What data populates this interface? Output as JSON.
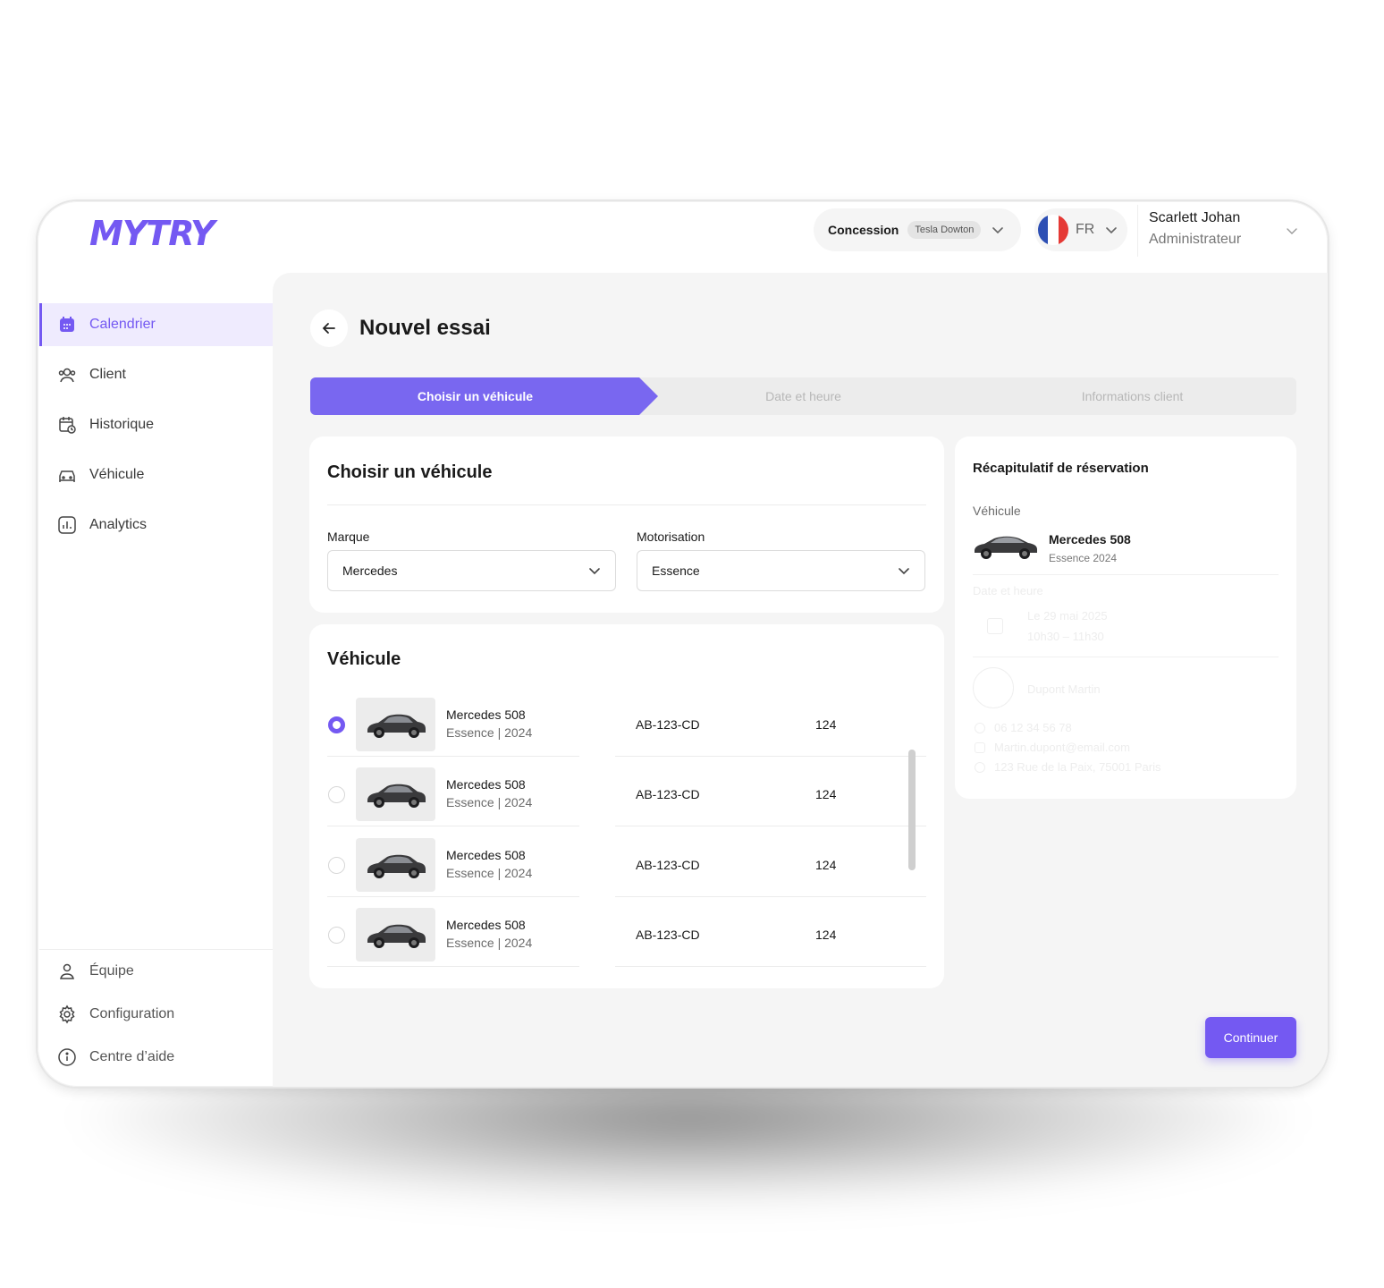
{
  "brand": {
    "logo_text": "MYTRY",
    "accent": "#7459f2"
  },
  "header": {
    "concession_label": "Concession",
    "concession_value": "Tesla Dowton",
    "language": "FR",
    "user_name": "Scarlett Johan",
    "user_role": "Administrateur"
  },
  "sidebar": {
    "items": [
      {
        "label": "Calendrier",
        "icon": "calendar-icon",
        "active": true
      },
      {
        "label": "Client",
        "icon": "users-icon"
      },
      {
        "label": "Historique",
        "icon": "calendar-clock-icon"
      },
      {
        "label": "Véhicule",
        "icon": "car-icon"
      },
      {
        "label": "Analytics",
        "icon": "chart-icon"
      }
    ],
    "bottom_items": [
      {
        "label": "Équipe",
        "icon": "user-icon"
      },
      {
        "label": "Configuration",
        "icon": "gear-icon"
      },
      {
        "label": "Centre d’aide",
        "icon": "info-icon"
      }
    ]
  },
  "page": {
    "title": "Nouvel essai"
  },
  "stepper": {
    "steps": [
      "Choisir un véhicule",
      "Date et heure",
      "Informations client"
    ],
    "active_index": 0
  },
  "filters": {
    "title": "Choisir un véhicule",
    "brand_label": "Marque",
    "brand_value": "Mercedes",
    "engine_label": "Motorisation",
    "engine_value": "Essence"
  },
  "vehicles": {
    "title": "Véhicule",
    "rows": [
      {
        "name": "Mercedes 508",
        "sub": "Essence | 2024",
        "plate": "AB-123-CD",
        "count": "124",
        "selected": true
      },
      {
        "name": "Mercedes 508",
        "sub": "Essence | 2024",
        "plate": "AB-123-CD",
        "count": "124",
        "selected": false
      },
      {
        "name": "Mercedes 508",
        "sub": "Essence | 2024",
        "plate": "AB-123-CD",
        "count": "124",
        "selected": false
      },
      {
        "name": "Mercedes 508",
        "sub": "Essence | 2024",
        "plate": "AB-123-CD",
        "count": "124",
        "selected": false
      }
    ]
  },
  "summary": {
    "title": "Récapitulatif de réservation",
    "vehicle_label": "Véhicule",
    "vehicle_name": "Mercedes 508",
    "vehicle_sub": "Essence  2024",
    "date_label": "Date et heure",
    "date": "Le 29 mai 2025",
    "time": "10h30 – 11h30",
    "client_name": "Dupont Martin",
    "phone": "06 12 34 56 78",
    "email": "Martin.dupont@email.com",
    "address": "123 Rue de la Paix, 75001 Paris"
  },
  "actions": {
    "continue": "Continuer"
  }
}
